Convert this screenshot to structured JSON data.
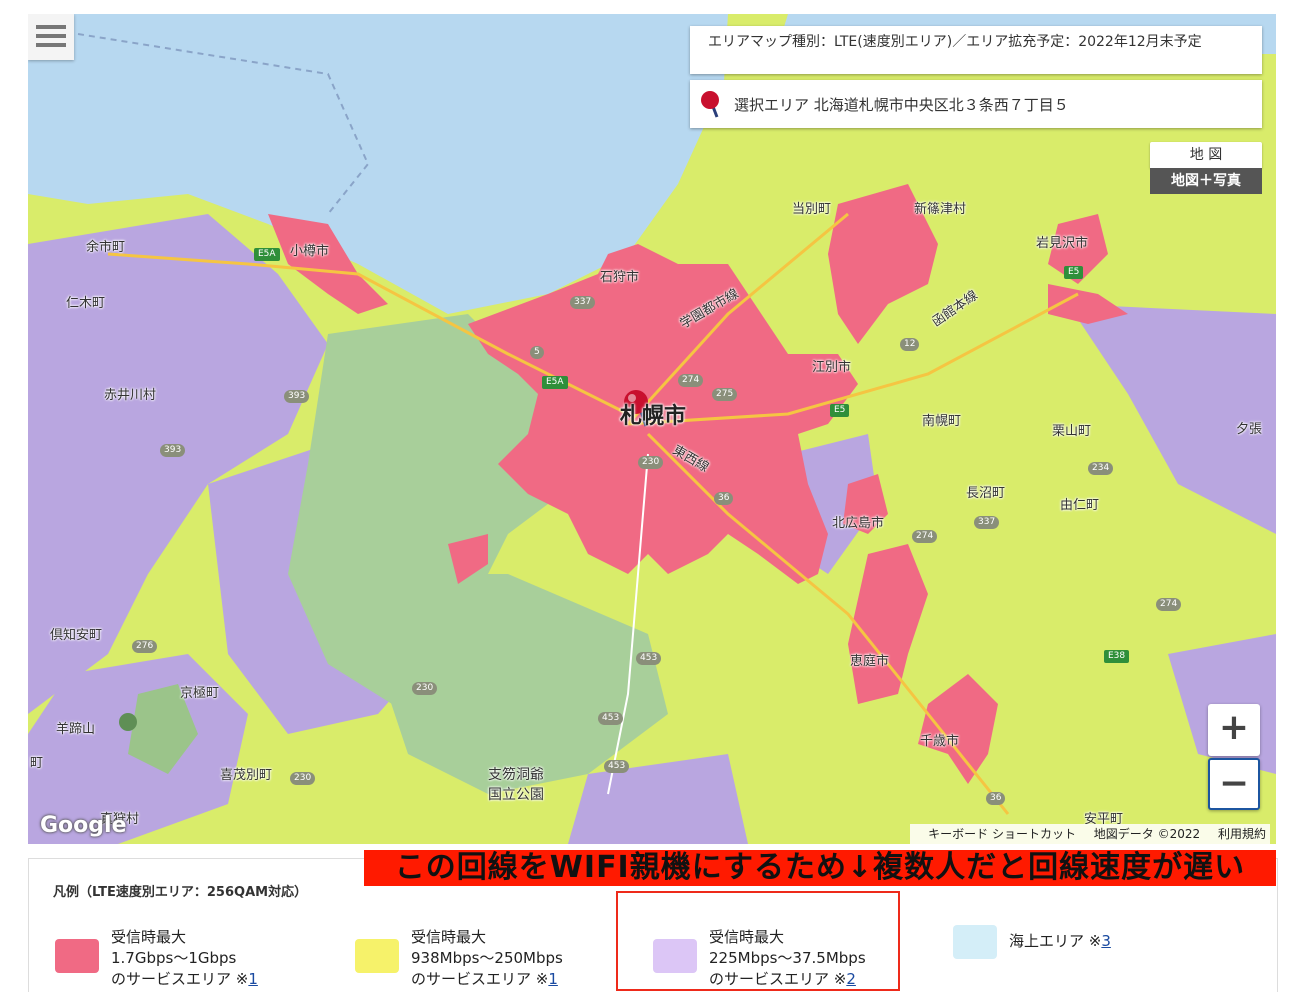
{
  "map": {
    "info_area_type": "エリアマップ種別：LTE(速度別エリア)／エリア拡充予定：2022年12月末予定",
    "selected_area": "選択エリア 北海道札幌市中央区北３条西７丁目５",
    "map_type_buttons": [
      "地 図",
      "地図＋写真"
    ],
    "zoom_in": "+",
    "zoom_out": "−",
    "google_logo": "Google",
    "attribution": [
      "キーボード ショートカット",
      "地図データ ©2022",
      "利用規約"
    ],
    "places": {
      "sapporo": "札幌市",
      "otaru": "小樽市",
      "ishikari": "石狩市",
      "tobetsu": "当別町",
      "shinshinotsu": "新篠津村",
      "iwamizawa": "岩見沢市",
      "yoichi": "余市町",
      "niki": "仁木町",
      "akaigawa": "赤井川村",
      "ebetsu": "江別市",
      "nanporo": "南幌町",
      "kuriyama": "栗山町",
      "yubari": "夕張",
      "naganuma": "長沼町",
      "yuni": "由仁町",
      "kitahiroshima": "北広島市",
      "eniwa": "恵庭市",
      "chitose": "千歳市",
      "abira": "安平町",
      "kutchan": "倶知安町",
      "kyogoku": "京極町",
      "yoteizan": "羊蹄山",
      "kimobetsu": "喜茂別町",
      "makkari": "真狩村",
      "shikotsu_park_1": "支笏洞爺",
      "shikotsu_park_2": "国立公園",
      "gakuen_line": "学園都市線",
      "hakodate_line": "函館本線",
      "tozai_line": "東西線",
      "cho_left": "町"
    },
    "routes": [
      "337",
      "5",
      "274",
      "275",
      "12",
      "393",
      "393",
      "230",
      "36",
      "274",
      "234",
      "337",
      "274",
      "276",
      "453",
      "453",
      "230",
      "230",
      "453",
      "36",
      "E5A",
      "E5A",
      "E5",
      "E5",
      "E38"
    ]
  },
  "legend": {
    "title": "凡例（LTE速度別エリア：256QAM対応）",
    "items": [
      {
        "line1": "受信時最大",
        "line2": "1.7Gbps〜1Gbps",
        "line3": "のサービスエリア ※",
        "note": "1",
        "color": "#f06a84"
      },
      {
        "line1": "受信時最大",
        "line2": "938Mbps〜250Mbps",
        "line3": "のサービスエリア ※",
        "note": "1",
        "color": "#f6f26a"
      },
      {
        "line1": "受信時最大",
        "line2": "225Mbps〜37.5Mbps",
        "line3": "のサービスエリア ※",
        "note": "2",
        "color": "#dcc6f6"
      },
      {
        "line1": "海上エリア ※",
        "line2": "",
        "line3": "",
        "note": "3",
        "color": "#d4eef8"
      }
    ]
  },
  "annotation": {
    "banner": "この回線をWIFI親機にするため↓複数人だと回線速度が遅い"
  },
  "colors": {
    "sea": "#b7d8f0",
    "area_1gbps": "#f06a84",
    "area_250mbps": "#d9ec6a",
    "area_37mbps": "#b9a6e0",
    "forest": "#a8cf9a",
    "banner_bg": "#ff1a00"
  }
}
